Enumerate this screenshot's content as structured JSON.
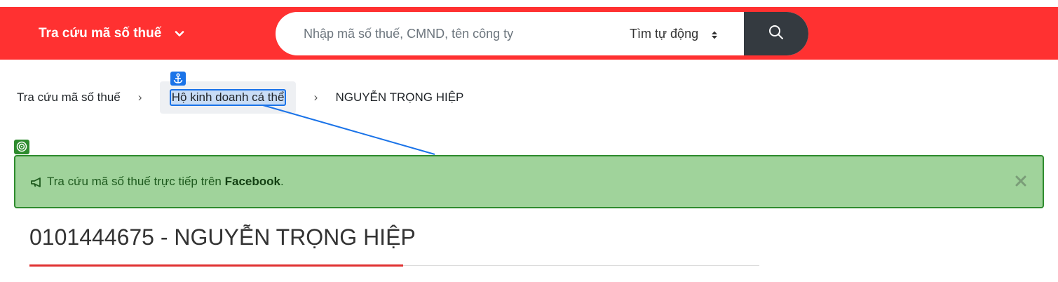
{
  "header": {
    "brand_label": "Tra cứu mã số thuế",
    "search_placeholder": "Nhập mã số thuế, CMND, tên công ty",
    "search_mode": "Tìm tự động",
    "search_button_icon": "search-icon",
    "brand_color": "#ff3131"
  },
  "breadcrumb": {
    "items": [
      {
        "label": "Tra cứu mã số thuế"
      },
      {
        "label": "Hộ kinh doanh cá thể"
      },
      {
        "label": "NGUYỄN TRỌNG HIỆP"
      }
    ],
    "separator": "›"
  },
  "overlay": {
    "anchor_icon": "anchor-icon",
    "target_icon": "target-icon",
    "anchor_color": "#1a73e8",
    "target_color": "#2e8b2e"
  },
  "alert": {
    "text_before": "Tra cứu mã số thuế trực tiếp trên ",
    "link_text": "Facebook",
    "text_after": ".",
    "icon": "megaphone-icon",
    "close_icon": "close-icon",
    "background": "#a0d39b"
  },
  "main": {
    "title": "0101444675 - NGUYỄN TRỌNG HIỆP"
  }
}
